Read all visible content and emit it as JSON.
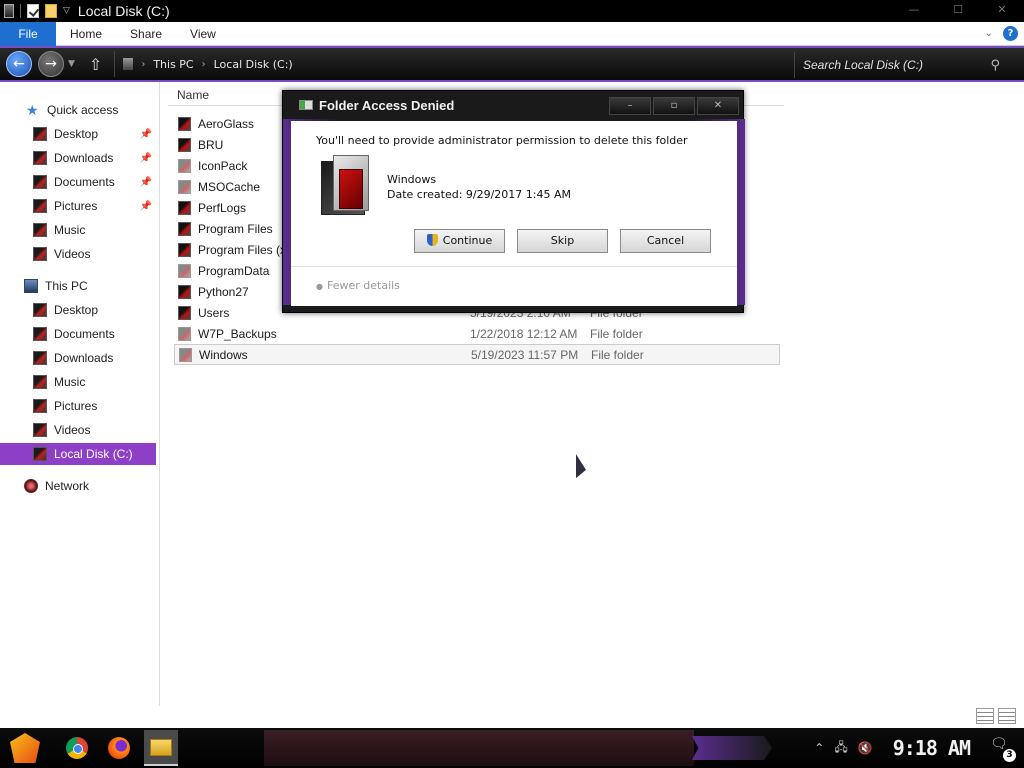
{
  "window": {
    "title": "Local Disk (C:)",
    "controls": {
      "minimize": "—",
      "maximize": "☐",
      "close": "✕"
    }
  },
  "ribbon": {
    "tabs": [
      "File",
      "Home",
      "Share",
      "View"
    ],
    "help": "?"
  },
  "address": {
    "crumbs": [
      "This PC",
      "Local Disk (C:)"
    ],
    "search_placeholder": "Search Local Disk (C:)"
  },
  "sidebar": {
    "quick_access": "Quick access",
    "quick_items": [
      "Desktop",
      "Downloads",
      "Documents",
      "Pictures",
      "Music",
      "Videos"
    ],
    "this_pc": "This PC",
    "pc_items": [
      "Desktop",
      "Documents",
      "Downloads",
      "Music",
      "Pictures",
      "Videos",
      "Local Disk (C:)"
    ],
    "network": "Network"
  },
  "list": {
    "header_name": "Name",
    "rows": [
      {
        "name": "AeroGlass",
        "date": "",
        "type": ""
      },
      {
        "name": "BRU",
        "date": "",
        "type": ""
      },
      {
        "name": "IconPack",
        "date": "",
        "type": ""
      },
      {
        "name": "MSOCache",
        "date": "",
        "type": ""
      },
      {
        "name": "PerfLogs",
        "date": "",
        "type": ""
      },
      {
        "name": "Program Files",
        "date": "",
        "type": ""
      },
      {
        "name": "Program Files (x86)",
        "date": "",
        "type": ""
      },
      {
        "name": "ProgramData",
        "date": "",
        "type": ""
      },
      {
        "name": "Python27",
        "date": "",
        "type": ""
      },
      {
        "name": "Users",
        "date": "5/19/2023 2:10 AM",
        "type": "File folder"
      },
      {
        "name": "W7P_Backups",
        "date": "1/22/2018 12:12 AM",
        "type": "File folder"
      },
      {
        "name": "Windows",
        "date": "5/19/2023 11:57 PM",
        "type": "File folder"
      }
    ]
  },
  "dialog": {
    "title": "Folder Access Denied",
    "message": "You'll need to provide administrator permission to delete this folder",
    "folder_name": "Windows",
    "date_created": "Date created: 9/29/2017 1:45 AM",
    "buttons": {
      "continue": "Continue",
      "skip": "Skip",
      "cancel": "Cancel"
    },
    "fewer_details": "Fewer details",
    "controls": {
      "minimize": "–",
      "maximize": "▫",
      "close": "✕"
    }
  },
  "taskbar": {
    "clock": "9:18 AM",
    "notification_count": "3"
  },
  "colors": {
    "accent_purple": "#8e3fc7",
    "file_tab_blue": "#1f6fd1"
  }
}
